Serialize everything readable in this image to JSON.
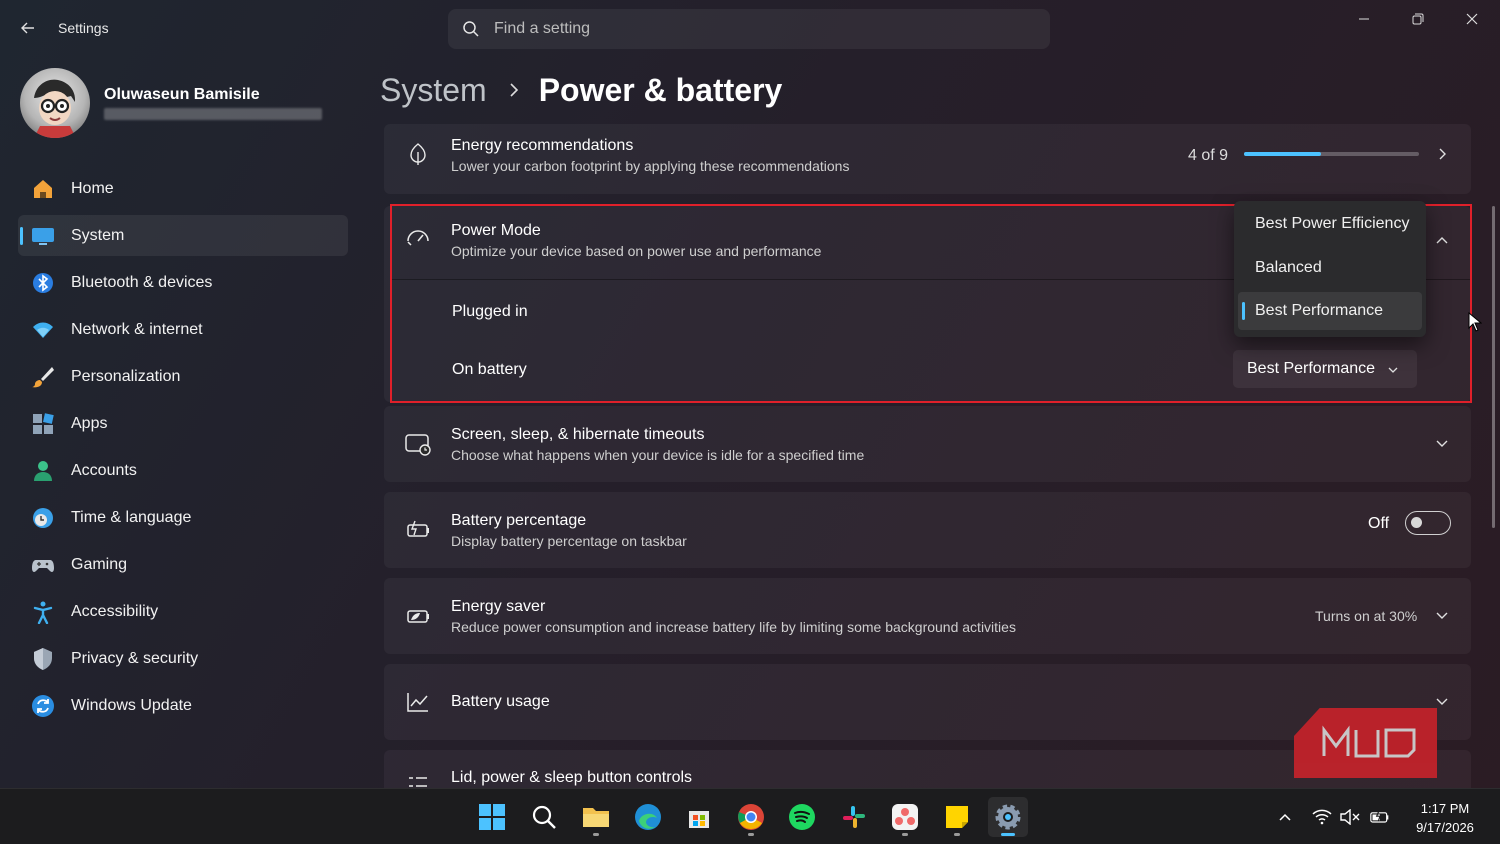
{
  "window": {
    "title": "Settings"
  },
  "search": {
    "placeholder": "Find a setting"
  },
  "user": {
    "name": "Oluwaseun Bamisile"
  },
  "sidebar": {
    "items": [
      {
        "label": "Home",
        "icon": "home-icon"
      },
      {
        "label": "System",
        "icon": "system-icon",
        "active": true
      },
      {
        "label": "Bluetooth & devices",
        "icon": "bluetooth-icon"
      },
      {
        "label": "Network & internet",
        "icon": "wifi-icon"
      },
      {
        "label": "Personalization",
        "icon": "brush-icon"
      },
      {
        "label": "Apps",
        "icon": "apps-icon"
      },
      {
        "label": "Accounts",
        "icon": "person-icon"
      },
      {
        "label": "Time & language",
        "icon": "clock-globe-icon"
      },
      {
        "label": "Gaming",
        "icon": "gamepad-icon"
      },
      {
        "label": "Accessibility",
        "icon": "accessibility-icon"
      },
      {
        "label": "Privacy & security",
        "icon": "shield-icon"
      },
      {
        "label": "Windows Update",
        "icon": "update-icon"
      }
    ]
  },
  "breadcrumb": {
    "parent": "System",
    "current": "Power & battery"
  },
  "energy_recommendations": {
    "title": "Energy recommendations",
    "subtitle": "Lower your carbon footprint by applying these recommendations",
    "progress_label": "4 of 9",
    "progress_fraction": 0.44
  },
  "power_mode": {
    "title": "Power Mode",
    "subtitle": "Optimize your device based on power use and performance",
    "plugged_in_label": "Plugged in",
    "on_battery_label": "On battery",
    "dropdown_options": [
      "Best Power Efficiency",
      "Balanced",
      "Best Performance"
    ],
    "plugged_in_value": "Best Performance",
    "on_battery_value": "Best Performance"
  },
  "screen_sleep": {
    "title": "Screen, sleep, & hibernate timeouts",
    "subtitle": "Choose what happens when your device is idle for a specified time"
  },
  "battery_percentage": {
    "title": "Battery percentage",
    "subtitle": "Display battery percentage on taskbar",
    "toggle_label": "Off",
    "toggle_on": false
  },
  "energy_saver": {
    "title": "Energy saver",
    "subtitle": "Reduce power consumption and increase battery life by limiting some background activities",
    "status": "Turns on at 30%"
  },
  "battery_usage": {
    "title": "Battery usage"
  },
  "lid_controls": {
    "title": "Lid, power & sleep button controls"
  },
  "taskbar": {
    "apps": [
      "start",
      "search",
      "file-explorer",
      "edge",
      "store",
      "chrome",
      "spotify",
      "slack",
      "asana",
      "sticky-notes",
      "settings"
    ],
    "time": "1:17 PM",
    "date": "9/17/2026"
  },
  "colors": {
    "accent": "#4cc2ff",
    "highlight_border": "#e0202a"
  }
}
